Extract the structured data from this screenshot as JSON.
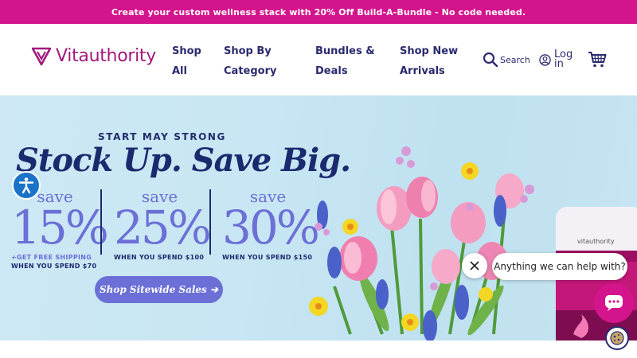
{
  "announcement": {
    "text": "Create your custom wellness stack with 20% Off Build-A-Bundle - No code needed."
  },
  "header": {
    "logo_text": "Vitauthority",
    "nav": [
      {
        "line1": "Shop",
        "line2": "All"
      },
      {
        "line1": "Shop By",
        "line2": "Category"
      },
      {
        "line1": "Bundles &",
        "line2": "Deals"
      },
      {
        "line1": "Shop New",
        "line2": "Arrivals"
      }
    ],
    "search_label": "Search",
    "login_label": "Log in"
  },
  "hero": {
    "eyebrow": "START MAY STRONG",
    "title": "Stock Up. Save Big.",
    "offers": [
      {
        "save": "save",
        "percent": "15%",
        "note_accent": "+GET FREE SHIPPING",
        "note": "WHEN YOU SPEND $70"
      },
      {
        "save": "save",
        "percent": "25%",
        "note_accent": "",
        "note": "WHEN YOU SPEND $100"
      },
      {
        "save": "save",
        "percent": "30%",
        "note_accent": "",
        "note": "WHEN YOU SPEND $150"
      }
    ],
    "cta_label": "Shop Sitewide Sales ➔",
    "product_label": "vitauthority"
  },
  "chat": {
    "prompt": "Anything we can help with?"
  },
  "colors": {
    "brand_pink": "#d4148c",
    "navy": "#1b2a6e",
    "periwinkle": "#6b6fd6",
    "logo_magenta": "#a2197d"
  }
}
